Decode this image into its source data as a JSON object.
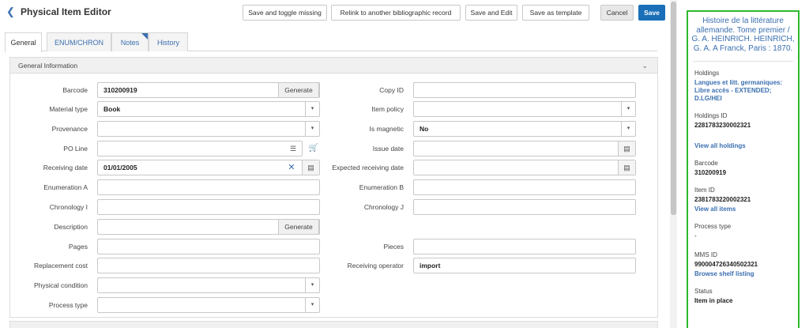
{
  "header": {
    "title": "Physical Item Editor",
    "back_icon": "chevron-left-icon",
    "buttons": {
      "save_toggle_missing": "Save and toggle missing",
      "relink": "Relink to another bibliographic record",
      "save_edit": "Save and Edit",
      "save_template": "Save as template",
      "cancel": "Cancel",
      "save": "Save"
    }
  },
  "tabs": [
    "General",
    "ENUM/CHRON",
    "Notes",
    "History"
  ],
  "section": {
    "title": "General Information"
  },
  "fields": {
    "barcode": {
      "label": "Barcode",
      "value": "310200919",
      "button": "Generate"
    },
    "material_type": {
      "label": "Material type",
      "value": "Book"
    },
    "provenance": {
      "label": "Provenance",
      "value": ""
    },
    "po_line": {
      "label": "PO Line",
      "value": ""
    },
    "receiving_date": {
      "label": "Receiving date",
      "value": "01/01/2005"
    },
    "enumeration_a": {
      "label": "Enumeration A",
      "value": ""
    },
    "chronology_i": {
      "label": "Chronology I",
      "value": ""
    },
    "description": {
      "label": "Description",
      "value": "",
      "button": "Generate"
    },
    "pages": {
      "label": "Pages",
      "value": ""
    },
    "replacement_cost": {
      "label": "Replacement cost",
      "value": ""
    },
    "physical_condition": {
      "label": "Physical condition",
      "value": ""
    },
    "process_type": {
      "label": "Process type",
      "value": ""
    },
    "copy_id": {
      "label": "Copy ID",
      "value": ""
    },
    "item_policy": {
      "label": "Item policy",
      "value": ""
    },
    "is_magnetic": {
      "label": "Is magnetic",
      "value": "No"
    },
    "issue_date": {
      "label": "Issue date",
      "value": ""
    },
    "expected_receiving_date": {
      "label": "Expected receiving date",
      "value": ""
    },
    "enumeration_b": {
      "label": "Enumeration B",
      "value": ""
    },
    "chronology_j": {
      "label": "Chronology J",
      "value": ""
    },
    "pieces": {
      "label": "Pieces",
      "value": ""
    },
    "receiving_operator": {
      "label": "Receiving operator",
      "value": "import"
    }
  },
  "sidebar": {
    "title": "Histoire de la littérature allemande. Tome premier / G. A. HEINRICH. HEINRICH, G. A. A Franck, Paris : 1870.",
    "holdings_label": "Holdings",
    "holdings_value": "Langues et litt. germaniques: Libre accès - EXTENDED; D.LG/HEI",
    "holdings_id_label": "Holdings ID",
    "holdings_id_value": "2281783230002321",
    "view_all_holdings": "View all holdings",
    "barcode_label": "Barcode",
    "barcode_value": "310200919",
    "item_id_label": "Item ID",
    "item_id_value": "2381783220002321",
    "view_all_items": "View all items",
    "process_type_label": "Process type",
    "process_type_value": "-",
    "mms_id_label": "MMS ID",
    "mms_id_value": "990004726340502321",
    "browse_shelf": "Browse shelf listing",
    "status_label": "Status",
    "status_value": "Item in place"
  },
  "colors": {
    "accent": "#1a6fb8",
    "link": "#3a6fb0",
    "highlight_border": "#2eb82e"
  }
}
